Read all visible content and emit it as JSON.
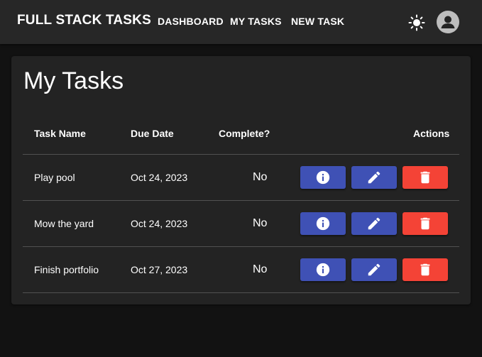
{
  "app": {
    "title": "FULL STACK TASKS",
    "nav": [
      {
        "label": "DASHBOARD"
      },
      {
        "label": "MY TASKS"
      },
      {
        "label": "NEW TASK"
      }
    ],
    "theme_icon": "sun-icon",
    "account_icon": "account-circle-icon"
  },
  "page": {
    "title": "My Tasks"
  },
  "table": {
    "columns": [
      "Task Name",
      "Due Date",
      "Complete?",
      "Actions"
    ],
    "rows": [
      {
        "name": "Play pool",
        "due": "Oct 24, 2023",
        "complete": "No"
      },
      {
        "name": "Mow the yard",
        "due": "Oct 24, 2023",
        "complete": "No"
      },
      {
        "name": "Finish portfolio",
        "due": "Oct 27, 2023",
        "complete": "No"
      }
    ],
    "action_icons": [
      "info-icon",
      "pencil-icon",
      "trash-icon"
    ]
  },
  "colors": {
    "appbar": "#272727",
    "background": "#121212",
    "card": "#232323",
    "primary": "#3f51b5",
    "danger": "#f44336"
  }
}
